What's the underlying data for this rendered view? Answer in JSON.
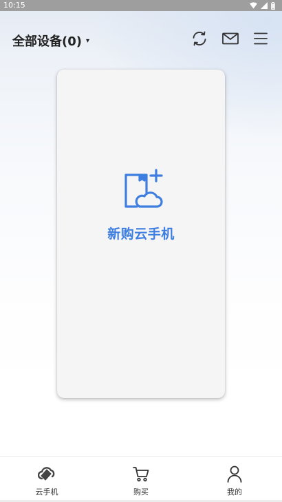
{
  "status_bar": {
    "time": "10:15",
    "icons": [
      "wifi-icon",
      "signal-icon",
      "battery-icon"
    ]
  },
  "header": {
    "device_selector_label": "全部设备(0)",
    "caret": "▾",
    "actions": [
      "refresh-icon",
      "mail-icon",
      "menu-icon"
    ]
  },
  "card": {
    "label": "新购云手机",
    "icon": "new-cloud-phone-icon"
  },
  "bottom_nav": {
    "items": [
      {
        "label": "云手机",
        "icon": "cloud-phone-icon"
      },
      {
        "label": "购买",
        "icon": "cart-icon"
      },
      {
        "label": "我的",
        "icon": "user-icon"
      }
    ]
  },
  "colors": {
    "accent": "#3d7ee0",
    "status_bar": "#9e9e9e",
    "title_text": "#222222"
  }
}
